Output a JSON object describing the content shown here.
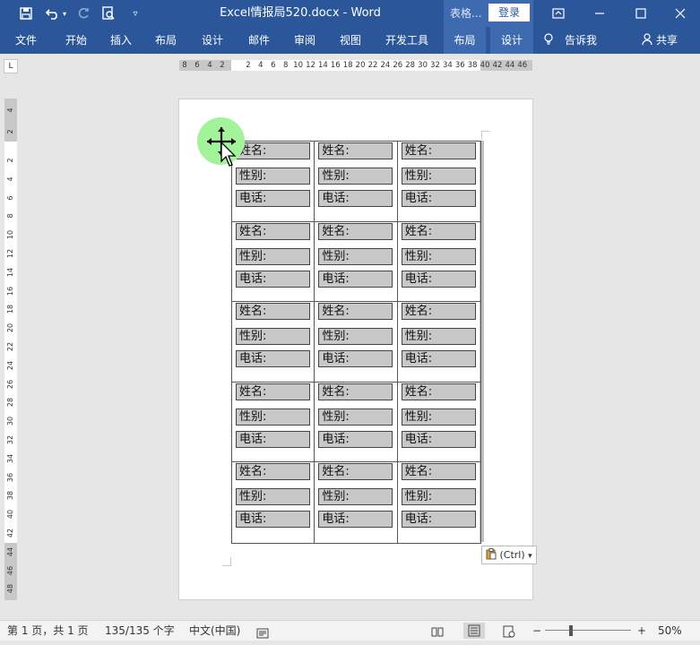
{
  "title_bar": {
    "document_title": "Excel情报局520.docx  -  Word",
    "table_tools_label": "表格...",
    "login_label": "登录",
    "icons": [
      "save-icon",
      "undo-icon",
      "redo-icon",
      "print-preview-icon",
      "customize-qat-icon",
      "ribbon-display-icon",
      "minimize-icon",
      "maximize-icon",
      "close-icon"
    ]
  },
  "ribbon": {
    "tabs": [
      "文件",
      "开始",
      "插入",
      "布局",
      "设计",
      "邮件",
      "审阅",
      "视图",
      "开发工具"
    ],
    "context_tabs": [
      "布局",
      "设计"
    ],
    "tell_me": "告诉我",
    "share": "共享"
  },
  "ruler": {
    "corner": "L",
    "h_left_numbers": [
      "8",
      "6",
      "4",
      "2"
    ],
    "h_right_numbers": [
      "2",
      "4",
      "6",
      "8",
      "10",
      "12",
      "14",
      "16",
      "18",
      "20",
      "22",
      "24",
      "26",
      "28",
      "30",
      "32",
      "34",
      "36",
      "38",
      "40",
      "42",
      "44",
      "46"
    ],
    "v_numbers": [
      "4",
      "2",
      "2",
      "4",
      "6",
      "8",
      "10",
      "12",
      "14",
      "16",
      "18",
      "20",
      "22",
      "24",
      "26",
      "28",
      "30",
      "32",
      "34",
      "36",
      "38",
      "40",
      "42",
      "44",
      "46",
      "48"
    ]
  },
  "card": {
    "name_label": "姓名:",
    "gender_label": "性别:",
    "phone_label": "电话:"
  },
  "grid": {
    "rows": 5,
    "cols": 3
  },
  "paste_options": {
    "label": "(Ctrl)",
    "arrow": "▾"
  },
  "status_bar": {
    "page_info": "第 1 页，共 1 页",
    "word_count": "135/135 个字",
    "language": "中文(中国)",
    "zoom": "50%",
    "zoom_fraction": 0.3
  }
}
